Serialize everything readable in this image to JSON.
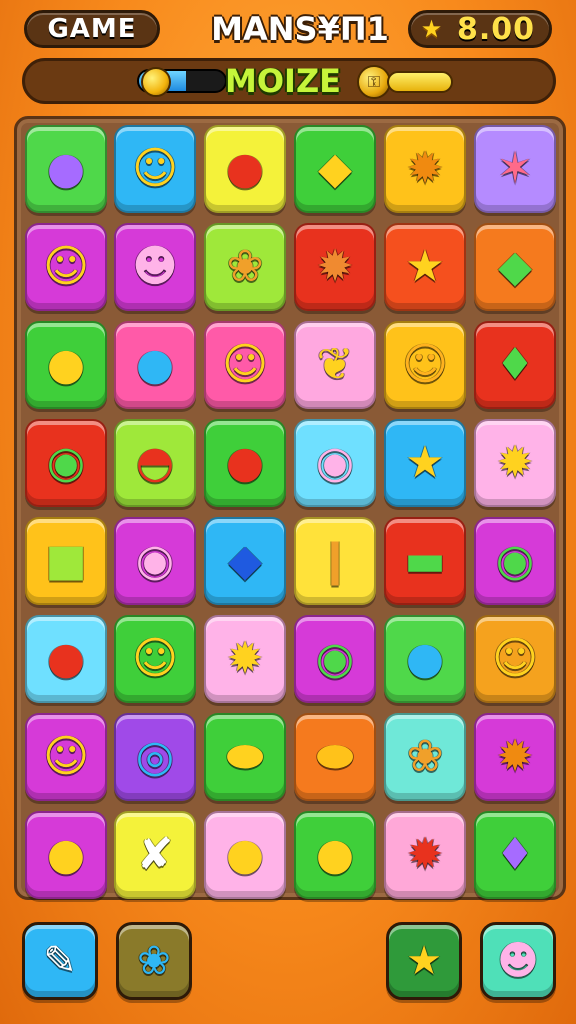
{
  "header": {
    "game_label": "GAME",
    "title": "MANS¥Π1",
    "score": "8.00",
    "score_icon": "star-coin-icon"
  },
  "subbar": {
    "mode_label": "MOIZE",
    "gauge_fill_fraction": 0.55,
    "key_icon": "key-icon"
  },
  "board": {
    "rows": [
      [
        {
          "color": "#4fd84a",
          "icon": "balloon-icon",
          "glyph": "●",
          "fg": "#a66bff"
        },
        {
          "color": "#2fb7f5",
          "icon": "smiley-lollipop-icon",
          "glyph": "☺",
          "fg": "#ffd21f"
        },
        {
          "color": "#f4f23a",
          "icon": "tomato-icon",
          "glyph": "●",
          "fg": "#e8321e"
        },
        {
          "color": "#3fcf3a",
          "icon": "lemon-icon",
          "glyph": "◆",
          "fg": "#ffd21f"
        },
        {
          "color": "#ffc21a",
          "icon": "sun-face-icon",
          "glyph": "✹",
          "fg": "#f08a10"
        },
        {
          "color": "#b58bff",
          "icon": "wand-icon",
          "glyph": "✶",
          "fg": "#ff6a8a"
        }
      ],
      [
        {
          "color": "#d63ad8",
          "icon": "smiley-lollipop-icon",
          "glyph": "☺",
          "fg": "#ffd21f"
        },
        {
          "color": "#d63ad8",
          "icon": "monster-face-icon",
          "glyph": "☻",
          "fg": "#ffb3e8"
        },
        {
          "color": "#9fe83a",
          "icon": "ice-cream-icon",
          "glyph": "❀",
          "fg": "#f0a02a"
        },
        {
          "color": "#e8321e",
          "icon": "spiky-star-icon",
          "glyph": "✹",
          "fg": "#f08a30"
        },
        {
          "color": "#f5501e",
          "icon": "star-icon",
          "glyph": "★",
          "fg": "#ffd21f"
        },
        {
          "color": "#f57a1e",
          "icon": "leaf-icon",
          "glyph": "◆",
          "fg": "#4fd84a"
        }
      ],
      [
        {
          "color": "#3fcf3a",
          "icon": "ice-cream-icon",
          "glyph": "●",
          "fg": "#ffd21f"
        },
        {
          "color": "#ff5aa8",
          "icon": "balloon-icon",
          "glyph": "●",
          "fg": "#2fb7f5"
        },
        {
          "color": "#ff5aa8",
          "icon": "smiley-lollipop-icon",
          "glyph": "☺",
          "fg": "#ffd21f"
        },
        {
          "color": "#ffa8e0",
          "icon": "figure-icon",
          "glyph": "❦",
          "fg": "#ffd21f"
        },
        {
          "color": "#ffc21a",
          "icon": "blob-face-icon",
          "glyph": "☺",
          "fg": "#ffb21f"
        },
        {
          "color": "#e8321e",
          "icon": "gem-icon",
          "glyph": "♦",
          "fg": "#4fd84a"
        }
      ],
      [
        {
          "color": "#e8321e",
          "icon": "donut-icon",
          "glyph": "◉",
          "fg": "#4fd84a"
        },
        {
          "color": "#9fe83a",
          "icon": "bowl-icon",
          "glyph": "◓",
          "fg": "#e8321e"
        },
        {
          "color": "#3fcf3a",
          "icon": "tomato-icon",
          "glyph": "●",
          "fg": "#e8321e"
        },
        {
          "color": "#6fe0ff",
          "icon": "donut-icon",
          "glyph": "◉",
          "fg": "#ffb3e8"
        },
        {
          "color": "#2fb7f5",
          "icon": "star-icon",
          "glyph": "★",
          "fg": "#ffd21f"
        },
        {
          "color": "#ffb3e8",
          "icon": "sun-face-icon",
          "glyph": "✹",
          "fg": "#ffd21f"
        }
      ],
      [
        {
          "color": "#ffc21a",
          "icon": "block-icon",
          "glyph": "■",
          "fg": "#9fe83a"
        },
        {
          "color": "#d63ad8",
          "icon": "donut-icon",
          "glyph": "◉",
          "fg": "#ffb3e8"
        },
        {
          "color": "#2fb7f5",
          "icon": "drop-icon",
          "glyph": "◆",
          "fg": "#1f5ae0"
        },
        {
          "color": "#ffe23a",
          "icon": "bowling-pin-icon",
          "glyph": "❙",
          "fg": "#f0a02a"
        },
        {
          "color": "#e8321e",
          "icon": "leaf-icon",
          "glyph": "▬",
          "fg": "#4fd84a"
        },
        {
          "color": "#d63ad8",
          "icon": "donut-icon",
          "glyph": "◉",
          "fg": "#4fd84a"
        }
      ],
      [
        {
          "color": "#6fe0ff",
          "icon": "tomato-icon",
          "glyph": "●",
          "fg": "#e8321e"
        },
        {
          "color": "#3fcf3a",
          "icon": "smiley-face-icon",
          "glyph": "☺",
          "fg": "#ffd21f"
        },
        {
          "color": "#ffb3e8",
          "icon": "sun-face-icon",
          "glyph": "✹",
          "fg": "#ffd21f"
        },
        {
          "color": "#d63ad8",
          "icon": "donut-icon",
          "glyph": "◉",
          "fg": "#4fd84a"
        },
        {
          "color": "#4fd84a",
          "icon": "balloon-icon",
          "glyph": "●",
          "fg": "#2fb7f5"
        },
        {
          "color": "#f5a21e",
          "icon": "smiley-face-icon",
          "glyph": "☺",
          "fg": "#ffd21f"
        }
      ],
      [
        {
          "color": "#d63ad8",
          "icon": "smiley-lollipop-icon",
          "glyph": "☺",
          "fg": "#ffd21f"
        },
        {
          "color": "#a04ae8",
          "icon": "swirl-lollipop-icon",
          "glyph": "◎",
          "fg": "#2fb7f5"
        },
        {
          "color": "#3fcf3a",
          "icon": "blob-icon",
          "glyph": "⬬",
          "fg": "#ffd21f"
        },
        {
          "color": "#f57a1e",
          "icon": "blob-icon",
          "glyph": "⬬",
          "fg": "#ffc21a"
        },
        {
          "color": "#6fe8d8",
          "icon": "ice-cream-icon",
          "glyph": "❀",
          "fg": "#f0a02a"
        },
        {
          "color": "#d63ad8",
          "icon": "gear-icon",
          "glyph": "✹",
          "fg": "#f08a10"
        }
      ],
      [
        {
          "color": "#d63ad8",
          "icon": "chick-icon",
          "glyph": "●",
          "fg": "#ffd21f"
        },
        {
          "color": "#f4f23a",
          "icon": "tongs-icon",
          "glyph": "✘",
          "fg": "#ffffff"
        },
        {
          "color": "#ffb3e8",
          "icon": "balloon-icon",
          "glyph": "●",
          "fg": "#ffd21f"
        },
        {
          "color": "#3fcf3a",
          "icon": "balloon-icon",
          "glyph": "●",
          "fg": "#ffd21f"
        },
        {
          "color": "#ffa8d8",
          "icon": "spiky-star-icon",
          "glyph": "✹",
          "fg": "#e8321e"
        },
        {
          "color": "#3fcf3a",
          "icon": "gem-icon",
          "glyph": "♦",
          "fg": "#a66bff"
        }
      ]
    ]
  },
  "footer": {
    "buttons": [
      {
        "name": "paint-brush-button",
        "icon": "paint-brush-icon",
        "glyph": "✎",
        "fg": "#ffffff",
        "color": "#2fb7f5"
      },
      {
        "name": "shuffle-button",
        "icon": "shuffle-icon",
        "glyph": "❀",
        "fg": "#2fb7f5",
        "color": "#8a7a2a"
      },
      {
        "name": "star-button",
        "icon": "star-icon",
        "glyph": "★",
        "fg": "#ffd21f",
        "color": "#2f9a3a"
      },
      {
        "name": "monster-button",
        "icon": "monster-face-icon",
        "glyph": "☻",
        "fg": "#ffb3e8",
        "color": "#4fe0b8"
      }
    ]
  }
}
